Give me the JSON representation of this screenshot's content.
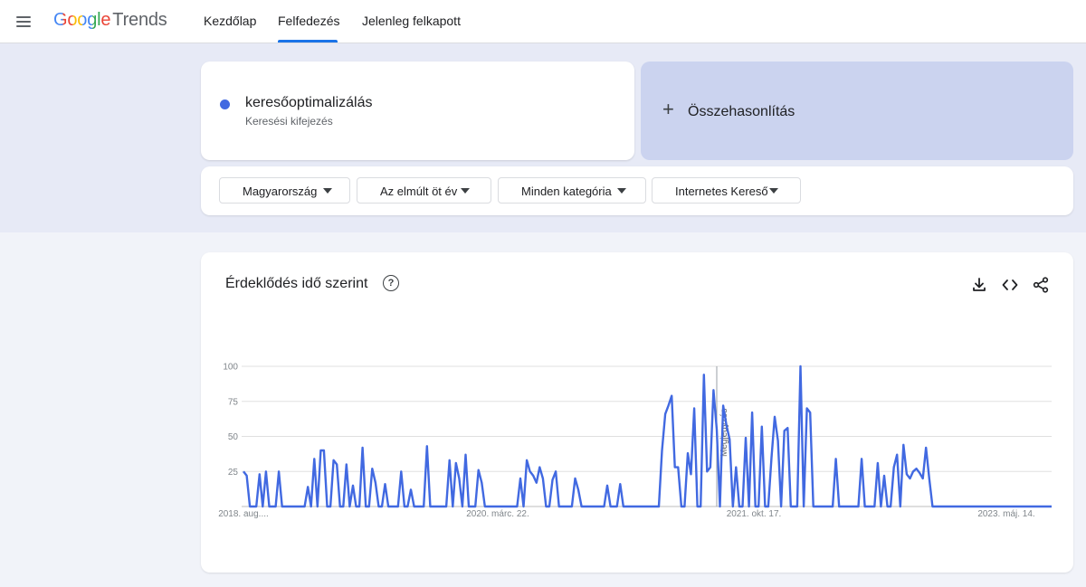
{
  "header": {
    "logo_google": "Google",
    "logo_trends": "Trends",
    "tabs": [
      {
        "label": "Kezdőlap"
      },
      {
        "label": "Felfedezés"
      },
      {
        "label": "Jelenleg felkapott"
      }
    ],
    "active_tab": "Felfedezés"
  },
  "search": {
    "term": "keresőoptimalizálás",
    "term_type": "Keresési kifejezés",
    "term_color": "#4169e1",
    "compare_label": "Összehasonlítás"
  },
  "filters": [
    {
      "label": "Magyarország"
    },
    {
      "label": "Az elmúlt öt év"
    },
    {
      "label": "Minden kategória"
    },
    {
      "label": "Internetes Kereső"
    }
  ],
  "chart_card": {
    "title": "Érdeklődés idő szerint",
    "help_glyph": "?",
    "tools": [
      "download-icon",
      "embed-icon",
      "share-icon"
    ]
  },
  "chart_data": {
    "type": "line",
    "yticks": [
      25,
      50,
      75,
      100
    ],
    "ylim": [
      0,
      100
    ],
    "xtick_labels": [
      "2018. aug....",
      "2020. márc. 22.",
      "2021. okt. 17.",
      "2023. máj. 14."
    ],
    "annotation": {
      "label": "Megjegyzés",
      "index": 147
    },
    "series": [
      {
        "color": "#4169e1",
        "values": [
          25,
          22,
          0,
          0,
          0,
          23,
          0,
          25,
          0,
          0,
          0,
          25,
          0,
          0,
          0,
          0,
          0,
          0,
          0,
          0,
          14,
          0,
          34,
          0,
          40,
          40,
          0,
          0,
          33,
          30,
          0,
          0,
          30,
          0,
          15,
          0,
          0,
          42,
          0,
          0,
          27,
          17,
          0,
          0,
          16,
          0,
          0,
          0,
          0,
          25,
          0,
          0,
          12,
          0,
          0,
          0,
          0,
          43,
          0,
          0,
          0,
          0,
          0,
          0,
          33,
          0,
          31,
          20,
          0,
          37,
          0,
          0,
          0,
          26,
          17,
          0,
          0,
          0,
          0,
          0,
          0,
          0,
          0,
          0,
          0,
          0,
          20,
          0,
          33,
          25,
          22,
          17,
          28,
          20,
          0,
          0,
          19,
          25,
          0,
          0,
          0,
          0,
          0,
          20,
          12,
          0,
          0,
          0,
          0,
          0,
          0,
          0,
          0,
          15,
          0,
          0,
          0,
          16,
          0,
          0,
          0,
          0,
          0,
          0,
          0,
          0,
          0,
          0,
          0,
          0,
          40,
          66,
          72,
          79,
          28,
          28,
          0,
          0,
          38,
          23,
          70,
          0,
          0,
          94,
          25,
          28,
          83,
          55,
          0,
          72,
          58,
          48,
          0,
          28,
          0,
          0,
          49,
          0,
          67,
          0,
          0,
          57,
          0,
          0,
          35,
          64,
          47,
          0,
          54,
          56,
          0,
          0,
          0,
          100,
          0,
          70,
          67,
          0,
          0,
          0,
          0,
          0,
          0,
          0,
          34,
          0,
          0,
          0,
          0,
          0,
          0,
          0,
          34,
          0,
          0,
          0,
          0,
          31,
          0,
          22,
          0,
          0,
          28,
          37,
          0,
          44,
          23,
          20,
          25,
          27,
          24,
          20,
          42,
          20,
          0,
          0,
          0,
          0,
          0,
          0,
          0,
          0,
          0,
          0,
          0,
          0,
          0,
          0,
          0,
          0,
          0,
          0,
          0,
          0,
          0,
          0,
          0,
          0,
          0,
          0,
          0,
          0,
          0,
          0,
          0,
          0,
          0,
          0,
          0,
          0,
          0,
          0
        ]
      }
    ]
  }
}
